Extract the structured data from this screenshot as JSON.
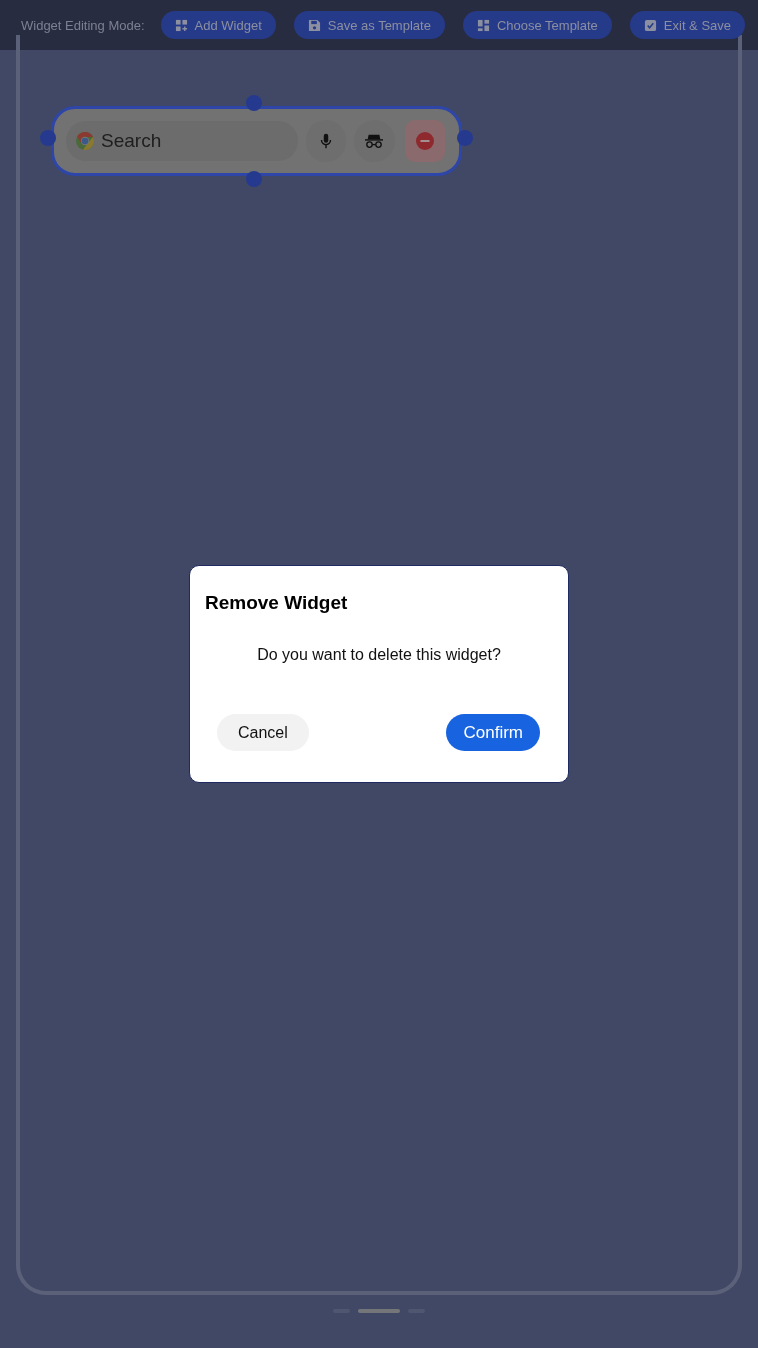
{
  "toolbar": {
    "label": "Widget Editing Mode:",
    "buttons": [
      {
        "label": "Add Widget"
      },
      {
        "label": "Save as Template"
      },
      {
        "label": "Choose Template"
      },
      {
        "label": "Exit & Save"
      }
    ]
  },
  "widget": {
    "placeholder": "Search",
    "selected": true
  },
  "dialog": {
    "title": "Remove Widget",
    "message": "Do you want to delete this widget?",
    "cancel": "Cancel",
    "confirm": "Confirm"
  },
  "pages": [
    {
      "selected": false
    },
    {
      "selected": true
    },
    {
      "selected": false
    }
  ]
}
